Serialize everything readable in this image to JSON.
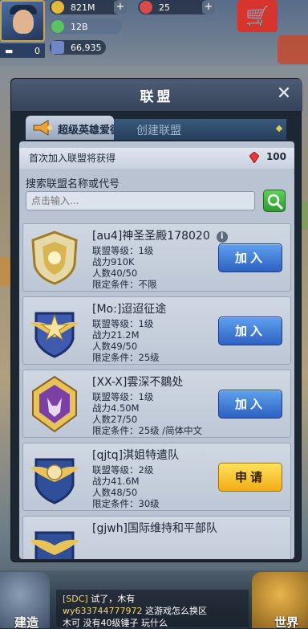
{
  "hud": {
    "resource_1": "821M",
    "resource_2": "25",
    "resource_3": "12B",
    "power": "66,935",
    "level": "0"
  },
  "modal": {
    "title": "联盟",
    "close_label": "✕",
    "tabs": [
      {
        "label": "超级英雄爱德华",
        "active": true
      },
      {
        "label": "创建联盟",
        "active": false
      }
    ]
  },
  "reward": {
    "text": "首次加入联盟将获得",
    "value": "100"
  },
  "search": {
    "label": "搜索联盟名称或代号",
    "placeholder": "点击输入..."
  },
  "alliances": [
    {
      "name": "[au4]神圣圣殿178020",
      "level": "联盟等级：1级",
      "power": "战力910K",
      "members": "人数40/50",
      "limit": "限定条件：不限",
      "action": "加入",
      "emblem_color": "#d8b453"
    },
    {
      "name": "[Mo:]迢迢征途",
      "level": "联盟等级：1级",
      "power": "战力21.2M",
      "members": "人数49/50",
      "limit": "限定条件：25级",
      "action": "加入",
      "emblem_color": "#3f5bb0"
    },
    {
      "name": "[XX-X]雲深不鶵处",
      "level": "联盟等级：1级",
      "power": "战力4.50M",
      "members": "人数27/50",
      "limit": "限定条件：25级 /简体中文",
      "action": "加入",
      "emblem_color": "#7b3fa6"
    },
    {
      "name": "[qjtq]淇姐特遣队",
      "level": "联盟等级：2级",
      "power": "战力41.6M",
      "members": "人数48/50",
      "limit": "限定条件：30级",
      "action": "申请",
      "emblem_color": "#2f4f98"
    },
    {
      "name": "[gjwh]国际维持和平部队",
      "level": "",
      "power": "",
      "members": "",
      "limit": "",
      "action": "",
      "emblem_color": "#2f4f98"
    }
  ],
  "bottom": {
    "build_label": "建造",
    "world_label": "世界",
    "chat_line_1_name": "[SDC]",
    "chat_line_1": "试了，木有",
    "chat_line_2_name": "wy633744777972",
    "chat_line_2": "这游戏怎么换区",
    "chat_line_3": "木可 没有40级锤子 玩什么"
  }
}
